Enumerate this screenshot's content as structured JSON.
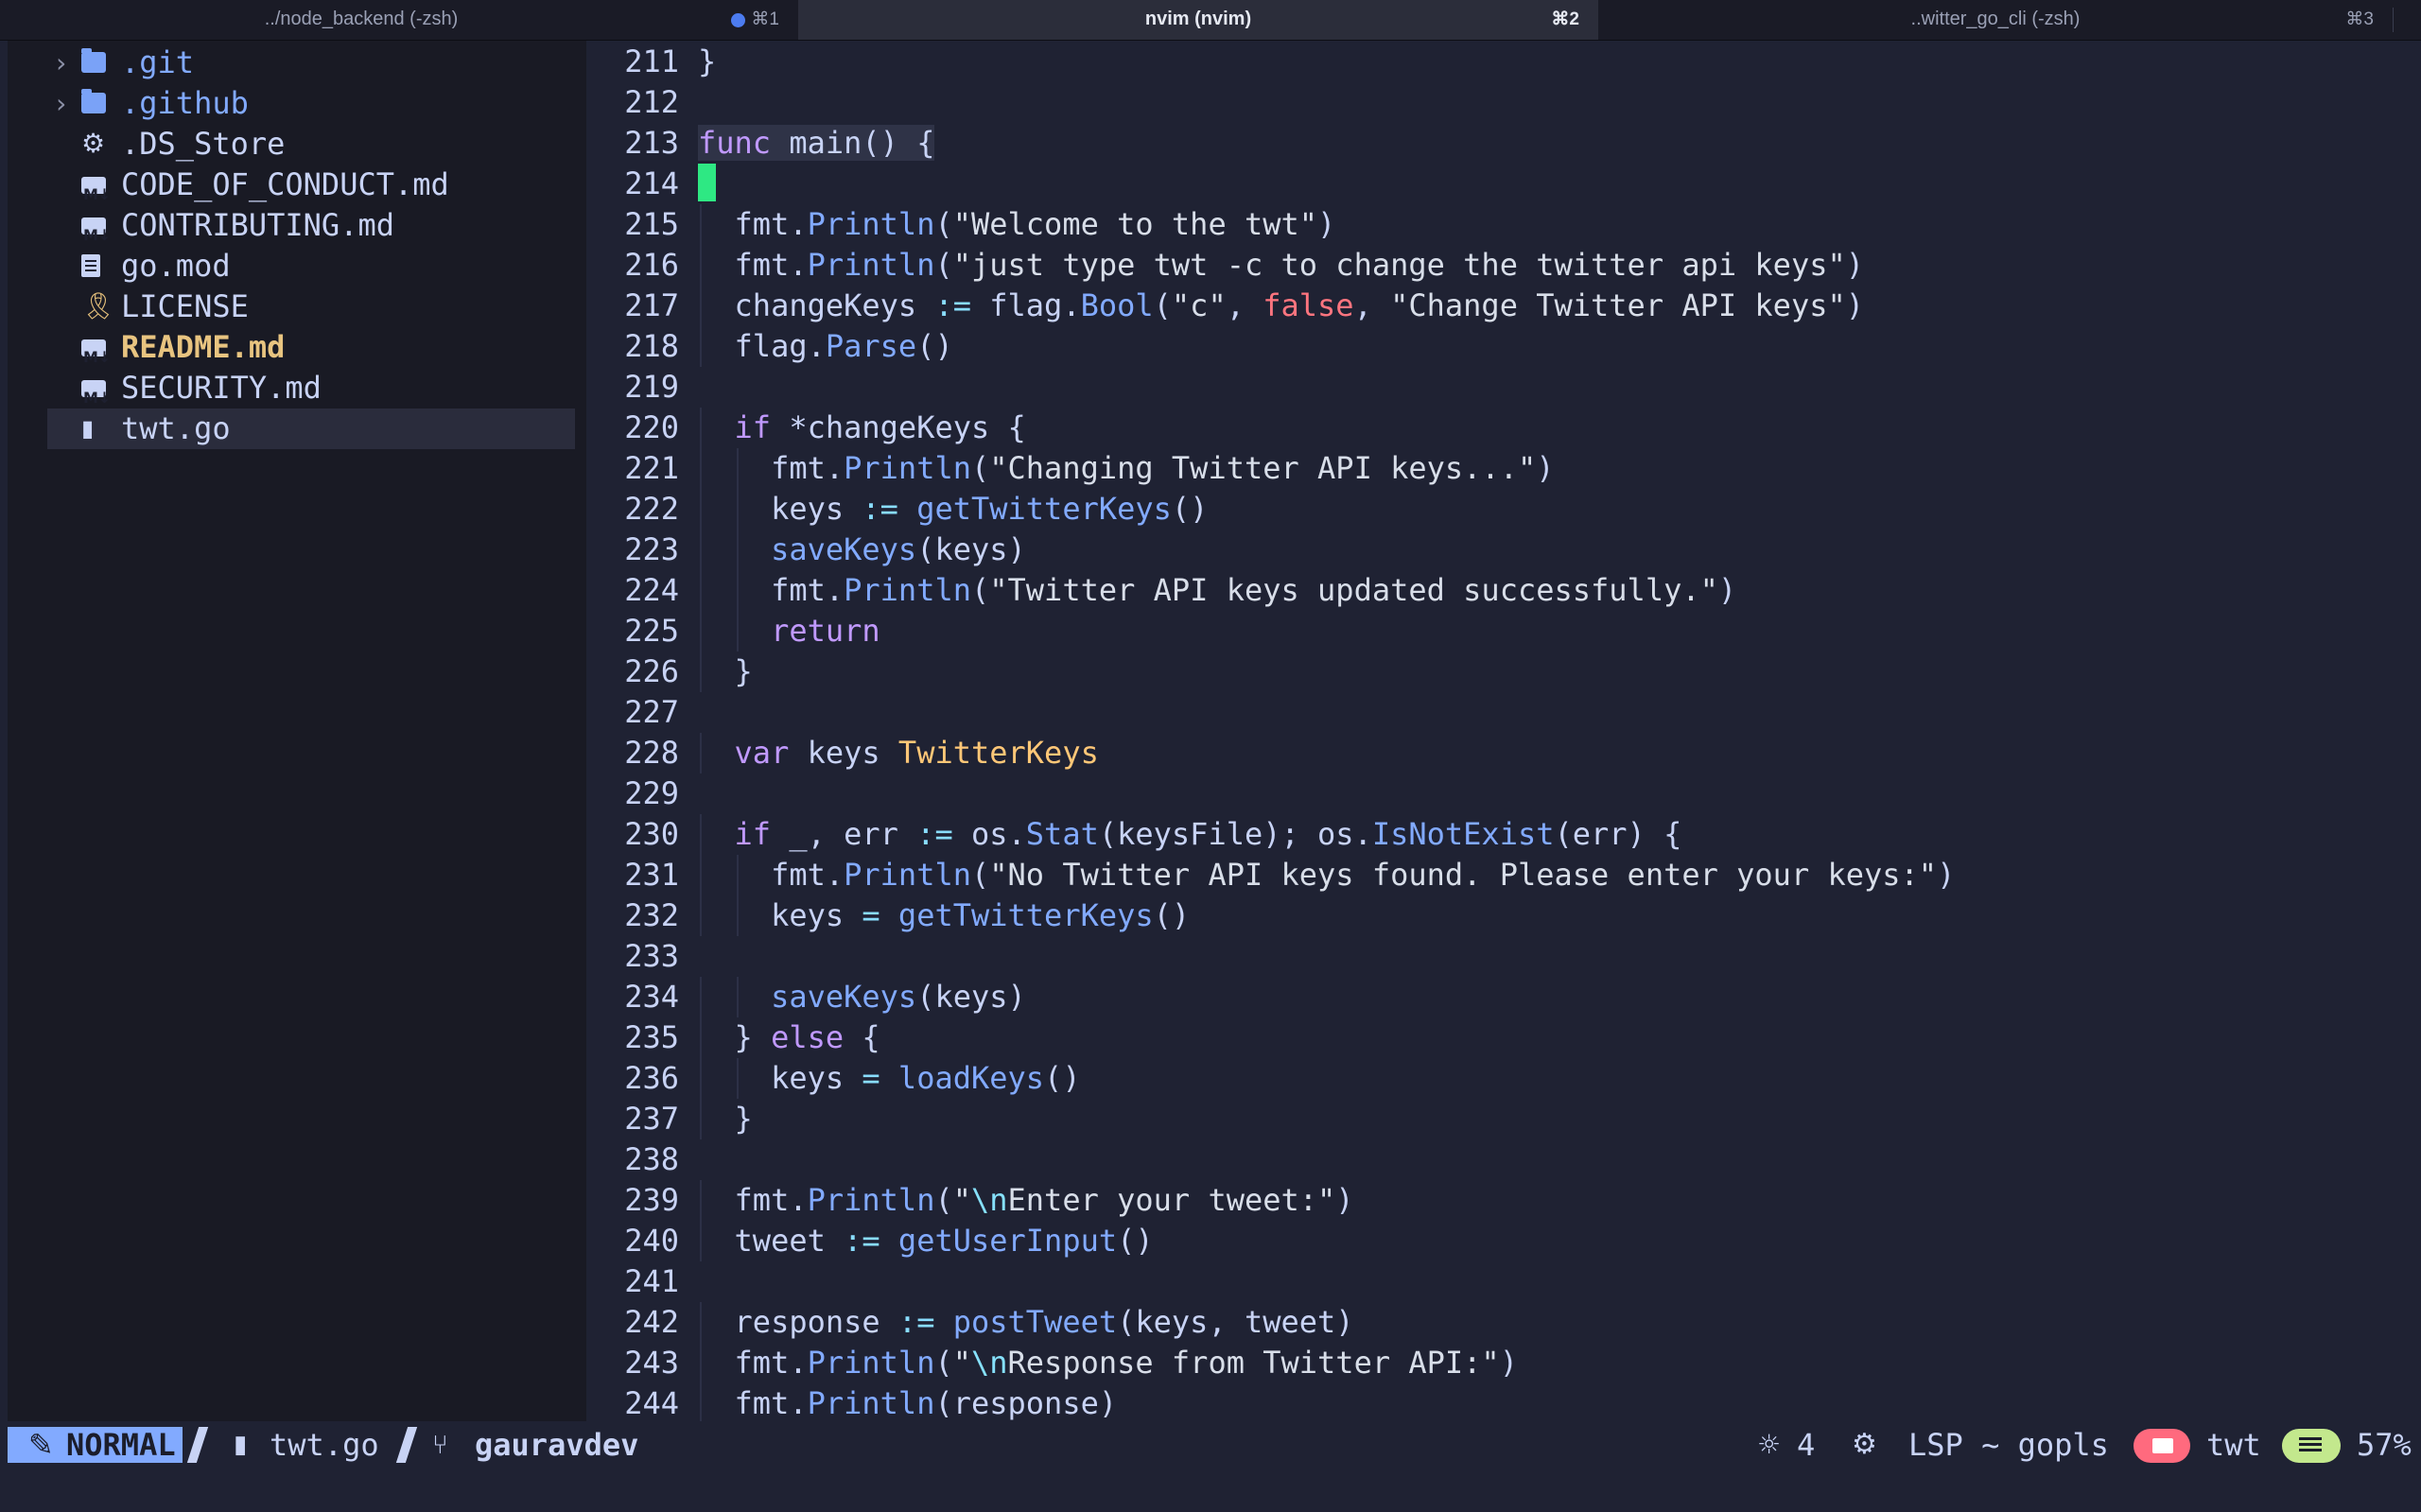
{
  "tabs": [
    {
      "title": "../node_backend (-zsh)",
      "shortcut": "⌘1",
      "has_dot": true
    },
    {
      "title": "nvim (nvim)",
      "shortcut": "⌘2"
    },
    {
      "title": "..witter_go_cli (-zsh)",
      "shortcut": "⌘3"
    }
  ],
  "file_tree": [
    {
      "name": ".git",
      "icon": "folder-icon",
      "type": "dir"
    },
    {
      "name": ".github",
      "icon": "folder-icon",
      "type": "dir"
    },
    {
      "name": ".DS_Store",
      "icon": "gear-icon",
      "type": "file"
    },
    {
      "name": "CODE_OF_CONDUCT.md",
      "icon": "markdown-icon",
      "type": "file"
    },
    {
      "name": "CONTRIBUTING.md",
      "icon": "markdown-icon",
      "type": "file"
    },
    {
      "name": "go.mod",
      "icon": "file-icon",
      "type": "file"
    },
    {
      "name": "LICENSE",
      "icon": "license-icon",
      "type": "file"
    },
    {
      "name": "README.md",
      "icon": "markdown-icon",
      "type": "file",
      "modified": true
    },
    {
      "name": "SECURITY.md",
      "icon": "markdown-icon",
      "type": "file"
    },
    {
      "name": "twt.go",
      "icon": "go-file-icon",
      "type": "file",
      "selected": true
    }
  ],
  "editor": {
    "line_numbers": [
      "211",
      "212",
      "213",
      "214",
      "215",
      "216",
      "217",
      "218",
      "219",
      "220",
      "221",
      "222",
      "223",
      "224",
      "225",
      "226",
      "227",
      "228",
      "229",
      "230",
      "231",
      "232",
      "233",
      "234",
      "235",
      "236",
      "237",
      "238",
      "239",
      "240",
      "241",
      "242",
      "243",
      "244"
    ],
    "lines": [
      "}",
      "",
      "func main() {",
      "",
      "  fmt.Println(\"Welcome to the twt\")",
      "  fmt.Println(\"just type twt -c to change the twitter api keys\")",
      "  changeKeys := flag.Bool(\"c\", false, \"Change Twitter API keys\")",
      "  flag.Parse()",
      "",
      "  if *changeKeys {",
      "    fmt.Println(\"Changing Twitter API keys...\")",
      "    keys := getTwitterKeys()",
      "    saveKeys(keys)",
      "    fmt.Println(\"Twitter API keys updated successfully.\")",
      "    return",
      "  }",
      "",
      "  var keys TwitterKeys",
      "",
      "  if _, err := os.Stat(keysFile); os.IsNotExist(err) {",
      "    fmt.Println(\"No Twitter API keys found. Please enter your keys:\")",
      "    keys = getTwitterKeys()",
      "",
      "    saveKeys(keys)",
      "  } else {",
      "    keys = loadKeys()",
      "  }",
      "",
      "  fmt.Println(\"\\nEnter your tweet:\")",
      "  tweet := getUserInput()",
      "",
      "  response := postTweet(keys, tweet)",
      "  fmt.Println(\"\\nResponse from Twitter API:\")",
      "  fmt.Println(response)"
    ]
  },
  "statusline": {
    "mode": "NORMAL",
    "file": "twt.go",
    "branch": "gauravdev",
    "diagnostics_count": "4",
    "lsp": "LSP ~ gopls",
    "project": "twt",
    "progress": "57%"
  },
  "colors": {
    "keyword": "#c099ff",
    "function": "#82aaff",
    "type": "#ffc777",
    "boolean": "#ff757f",
    "cursor": "#2ee883",
    "mode_bg": "#82aaff"
  }
}
